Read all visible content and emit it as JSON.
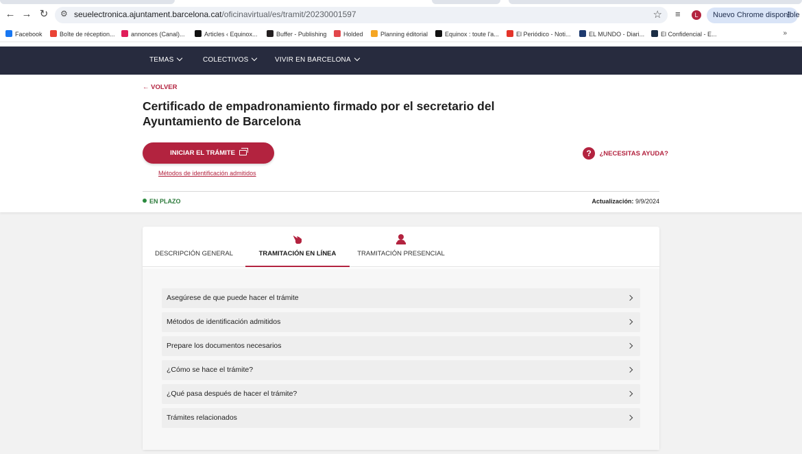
{
  "browser": {
    "url_host": "seuelectronica.ajuntament.barcelona.cat",
    "url_path": "/oficinavirtual/es/tramit/20230001597",
    "profile_initial": "L",
    "update_label": "Nuevo Chrome disponible",
    "icons": {
      "back": "arrow-left-icon",
      "forward": "arrow-right-icon",
      "reload": "reload-icon",
      "site_info": "tune-icon",
      "bookmark": "star-icon",
      "media": "media-controls-icon",
      "menu": "kebab-menu-icon"
    }
  },
  "bookmarks": [
    {
      "label": "Facebook",
      "color": "#1877f2"
    },
    {
      "label": "Boîte de réception...",
      "color": "#ea4335"
    },
    {
      "label": "annonces (Canal)...",
      "color": "#e01e5a"
    },
    {
      "label": "Articles ‹ Equinox...",
      "color": "#111111"
    },
    {
      "label": "Buffer - Publishing",
      "color": "#231f20"
    },
    {
      "label": "Holded",
      "color": "#e2474b"
    },
    {
      "label": "Planning éditorial",
      "color": "#f5a623"
    },
    {
      "label": "Equinox : toute l'a...",
      "color": "#111111"
    },
    {
      "label": "El Periódico - Noti...",
      "color": "#e4342a"
    },
    {
      "label": "EL MUNDO - Diari...",
      "color": "#1e3a6e"
    },
    {
      "label": "El Confidencial - E...",
      "color": "#1b2d45"
    }
  ],
  "site_nav": {
    "items": [
      "TEMAS",
      "COLECTIVOS",
      "VIVIR EN BARCELONA"
    ]
  },
  "header": {
    "back_label": "VOLVER",
    "title": "Certificado de empadronamiento firmado por el secretario del Ayuntamiento de Barcelona",
    "start_button": "INICIAR EL TRÁMITE",
    "id_methods_link": "Métodos de identificación admitidos",
    "help_label": "¿NECESITAS AYUDA?",
    "status": "EN PLAZO",
    "updated_label": "Actualización:",
    "updated_value": "9/9/2024"
  },
  "tabs": [
    {
      "label": "DESCRIPCIÓN GENERAL",
      "active": false,
      "icon": ""
    },
    {
      "label": "TRAMITACIÓN EN LÍNEA",
      "active": true,
      "icon": "pointing-hand-icon"
    },
    {
      "label": "TRAMITACIÓN PRESENCIAL",
      "active": false,
      "icon": "person-desk-icon"
    }
  ],
  "accordion": [
    "Asegúrese de que puede hacer el trámite",
    "Métodos de identificación admitidos",
    "Prepare los documentos necesarios",
    "¿Cómo se hace el trámite?",
    "¿Qué pasa después de hacer el trámite?",
    "Trámites relacionados"
  ],
  "colors": {
    "accent": "#b3233f",
    "nav_bg": "#272b3e",
    "status_green": "#2b7a3a"
  }
}
